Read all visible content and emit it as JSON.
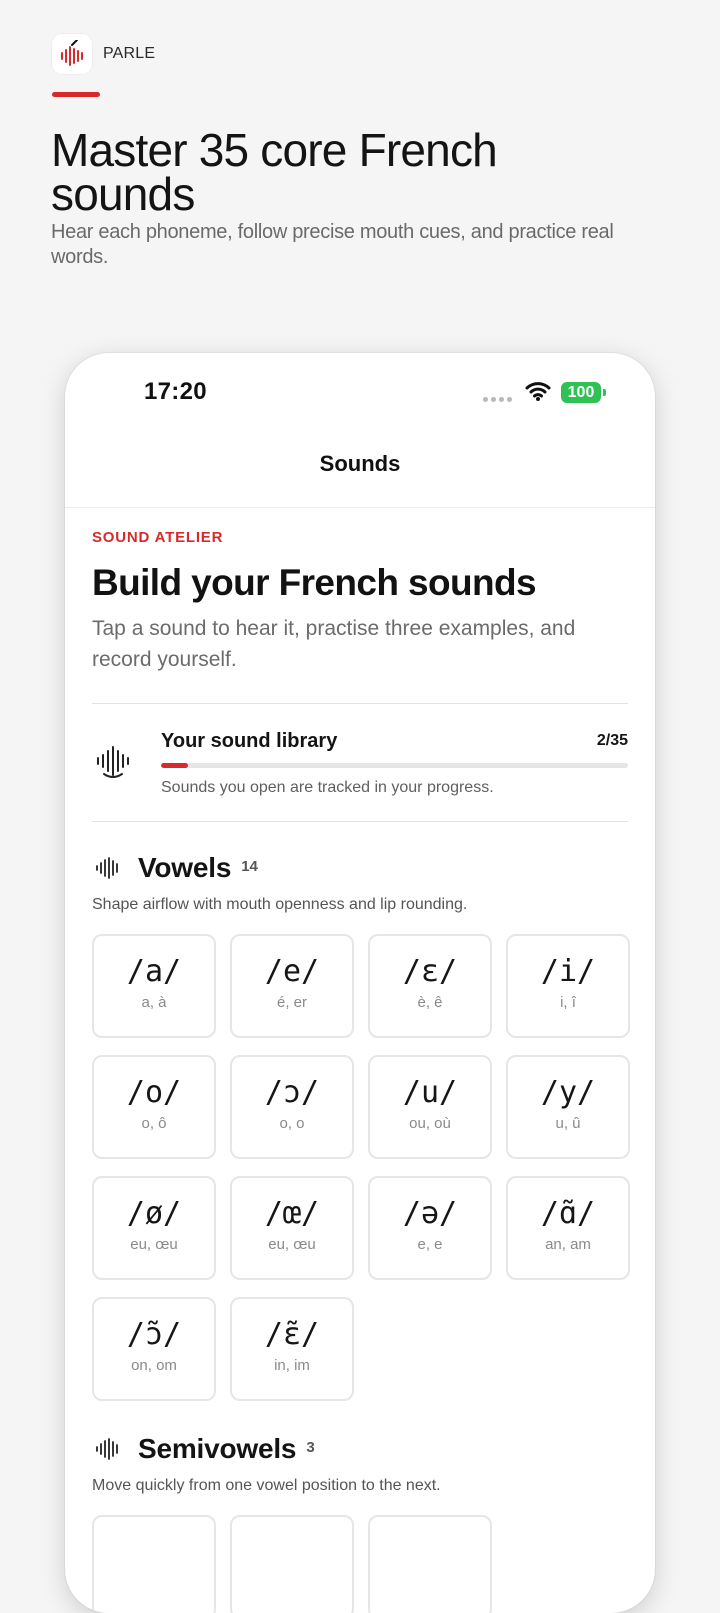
{
  "brand": {
    "name": "PARLE",
    "icon": "waveform-icon",
    "accent": "#d82a2a"
  },
  "hero": {
    "title": "Master 35 core French sounds",
    "subtitle": "Hear each phoneme, follow precise mouth cues, and practice real words."
  },
  "status_bar": {
    "time": "17:20",
    "battery": "100",
    "battery_color": "#30c155"
  },
  "nav": {
    "title": "Sounds"
  },
  "header": {
    "eyebrow": "SOUND ATELIER",
    "title": "Build your French sounds",
    "description": "Tap a sound to hear it, practise three examples, and record yourself."
  },
  "library": {
    "title": "Your sound library",
    "count": "2/35",
    "progress": 0.057,
    "note": "Sounds you open are tracked in your progress.",
    "icon": "sound-face-icon"
  },
  "sections": {
    "vowels": {
      "title": "Vowels",
      "count": "14",
      "description": "Shape airflow with mouth openness and lip rounding.",
      "sounds": [
        {
          "ipa": "/a/",
          "spelling": "a, à"
        },
        {
          "ipa": "/e/",
          "spelling": "é, er"
        },
        {
          "ipa": "/ɛ/",
          "spelling": "è, ê"
        },
        {
          "ipa": "/i/",
          "spelling": "i, î"
        },
        {
          "ipa": "/o/",
          "spelling": "o, ô"
        },
        {
          "ipa": "/ɔ/",
          "spelling": "o, o"
        },
        {
          "ipa": "/u/",
          "spelling": "ou, où"
        },
        {
          "ipa": "/y/",
          "spelling": "u, û"
        },
        {
          "ipa": "/ø/",
          "spelling": "eu, œu"
        },
        {
          "ipa": "/œ/",
          "spelling": "eu, œu"
        },
        {
          "ipa": "/ə/",
          "spelling": "e, e"
        },
        {
          "ipa": "/ɑ̃/",
          "spelling": "an, am"
        },
        {
          "ipa": "/ɔ̃/",
          "spelling": "on, om"
        },
        {
          "ipa": "/ɛ̃/",
          "spelling": "in, im"
        }
      ]
    },
    "semivowels": {
      "title": "Semivowels",
      "count": "3",
      "description": "Move quickly from one vowel position to the next."
    }
  }
}
